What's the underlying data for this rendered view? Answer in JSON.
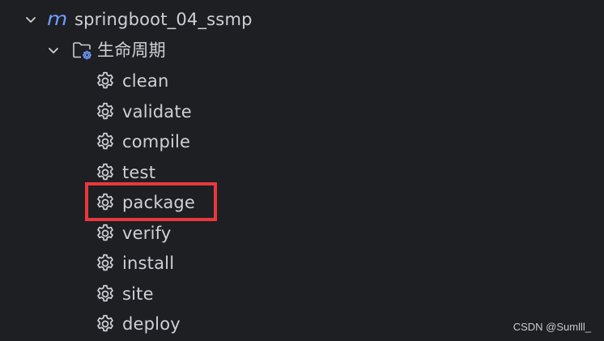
{
  "project": {
    "name": "springboot_04_ssmp",
    "icon": "maven-m-icon",
    "icon_glyph": "m",
    "expanded": true
  },
  "lifecycle": {
    "label": "生命周期",
    "icon": "lifecycle-folder-icon",
    "expanded": true
  },
  "goals": [
    {
      "label": "clean",
      "icon": "gear-icon"
    },
    {
      "label": "validate",
      "icon": "gear-icon"
    },
    {
      "label": "compile",
      "icon": "gear-icon"
    },
    {
      "label": "test",
      "icon": "gear-icon"
    },
    {
      "label": "package",
      "icon": "gear-icon",
      "highlighted": true
    },
    {
      "label": "verify",
      "icon": "gear-icon"
    },
    {
      "label": "install",
      "icon": "gear-icon"
    },
    {
      "label": "site",
      "icon": "gear-icon"
    },
    {
      "label": "deploy",
      "icon": "gear-icon"
    }
  ],
  "watermark": "CSDN @Sumlll_",
  "colors": {
    "background": "#1e1f22",
    "text": "#ced0d6",
    "maven_blue": "#6f9bff",
    "highlight": "#e8383d"
  }
}
